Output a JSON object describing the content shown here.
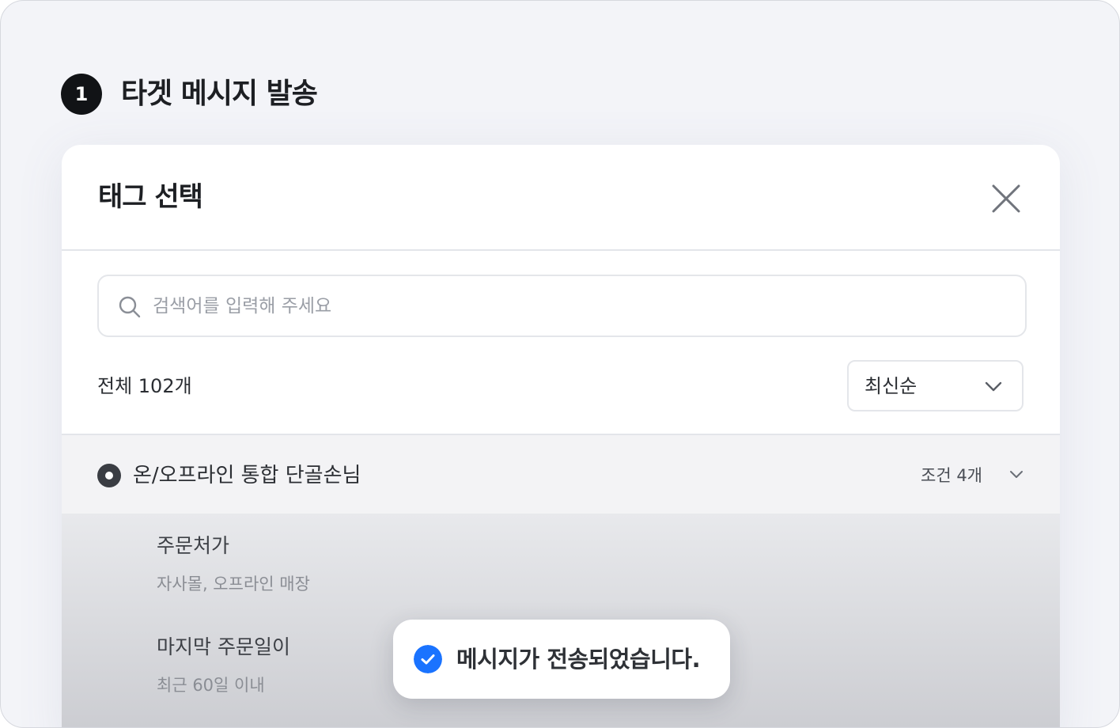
{
  "step": {
    "number": "1",
    "title": "타겟 메시지 발송"
  },
  "modal": {
    "title": "태그 선택",
    "close_icon": "close-icon",
    "search": {
      "placeholder": "검색어를 입력해 주세요",
      "value": "",
      "icon": "search-icon"
    },
    "total_count_label": "전체 102개",
    "sort": {
      "selected": "최신순",
      "icon": "chevron-down-icon"
    },
    "tags": [
      {
        "name": "온/오프라인 통합 단골손님",
        "condition_count": "조건 4개",
        "selected": true,
        "expanded": true,
        "conditions": [
          {
            "title": "주문처가",
            "value": "자사몰, 오프라인 매장"
          },
          {
            "title": "마지막 주문일이",
            "value": "최근 60일 이내"
          }
        ]
      }
    ]
  },
  "toast": {
    "message": "메시지가 전송되었습니다.",
    "icon": "check-circle-icon",
    "accent": "#1a73ff"
  }
}
